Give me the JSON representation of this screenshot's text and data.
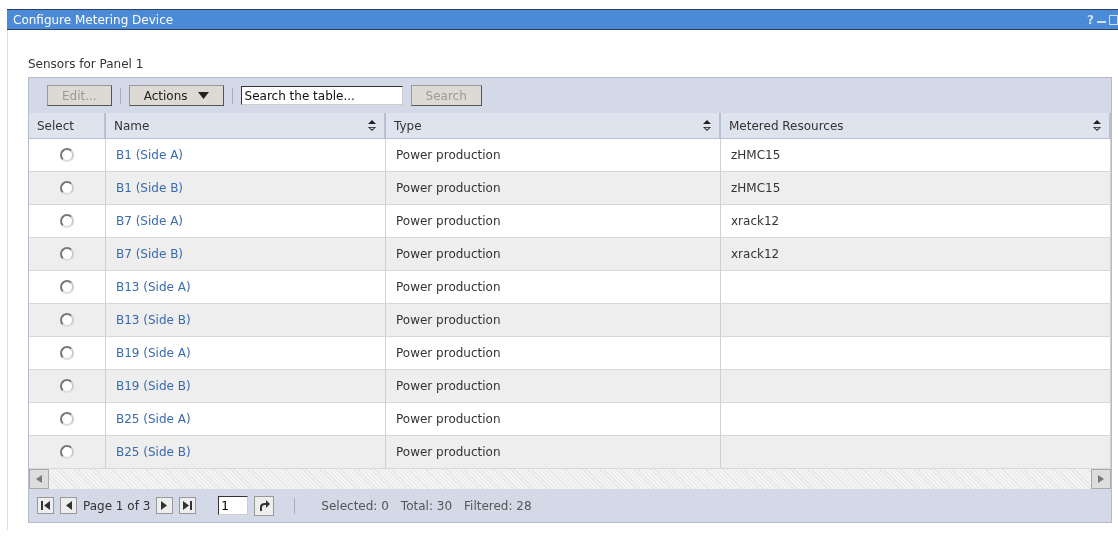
{
  "window": {
    "title": "Configure Metering Device",
    "help": "?"
  },
  "section_title": "Sensors for Panel 1",
  "toolbar": {
    "edit_button": {
      "label": "Edit...",
      "disabled": true
    },
    "actions_button": {
      "label": "Actions"
    },
    "search": {
      "placeholder": "Search the table..."
    },
    "search_button": {
      "label": "Search",
      "disabled": true
    }
  },
  "table": {
    "columns": [
      {
        "label": "Select",
        "sortable": false
      },
      {
        "label": "Name",
        "sortable": true
      },
      {
        "label": "Type",
        "sortable": true
      },
      {
        "label": "Metered Resources",
        "sortable": true
      }
    ],
    "rows": [
      {
        "selected": false,
        "name": "B1 (Side A)",
        "type": "Power production",
        "resource": "zHMC15"
      },
      {
        "selected": false,
        "name": "B1 (Side B)",
        "type": "Power production",
        "resource": "zHMC15"
      },
      {
        "selected": false,
        "name": "B7 (Side A)",
        "type": "Power production",
        "resource": "xrack12"
      },
      {
        "selected": false,
        "name": "B7 (Side B)",
        "type": "Power production",
        "resource": "xrack12"
      },
      {
        "selected": false,
        "name": "B13 (Side A)",
        "type": "Power production"
      },
      {
        "selected": false,
        "name": "B13 (Side B)",
        "type": "Power production"
      },
      {
        "selected": false,
        "name": "B19 (Side A)",
        "type": "Power production"
      },
      {
        "selected": false,
        "name": "B19 (Side B)",
        "type": "Power production"
      },
      {
        "selected": false,
        "name": "B25 (Side A)",
        "type": "Power production"
      },
      {
        "selected": false,
        "name": "B25 (Side B)",
        "type": "Power production"
      }
    ]
  },
  "pager": {
    "page_label": "Page 1 of 3",
    "page_input": "1",
    "selected": "Selected: 0",
    "total": "Total: 30",
    "filtered": "Filtered: 28"
  }
}
